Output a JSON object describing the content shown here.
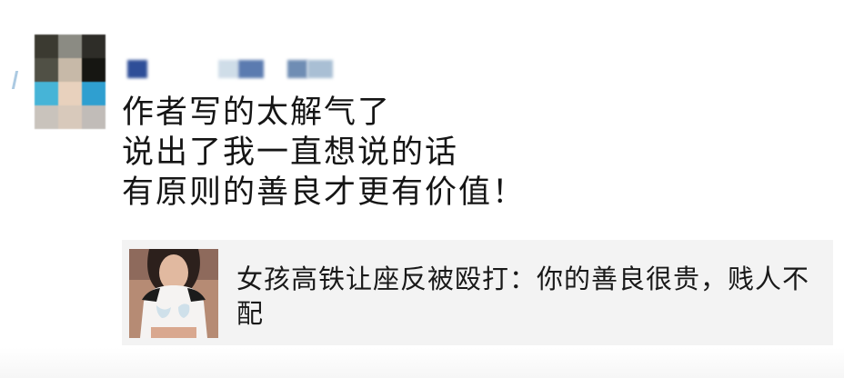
{
  "post": {
    "author_avatar_icon": "user-avatar-icon (pixelated)",
    "author_name": "",
    "text_lines": [
      "作者写的太解气了",
      "说出了我一直想说的话",
      "有原则的善良才更有价值！"
    ]
  },
  "link_card": {
    "thumbnail_icon": "article-thumbnail-photo",
    "title": "女孩高铁让座反被殴打：你的善良很贵，贱人不配"
  },
  "colors": {
    "text": "#151515",
    "card_background": "#f3f3f3",
    "page_background": "#ffffff"
  }
}
